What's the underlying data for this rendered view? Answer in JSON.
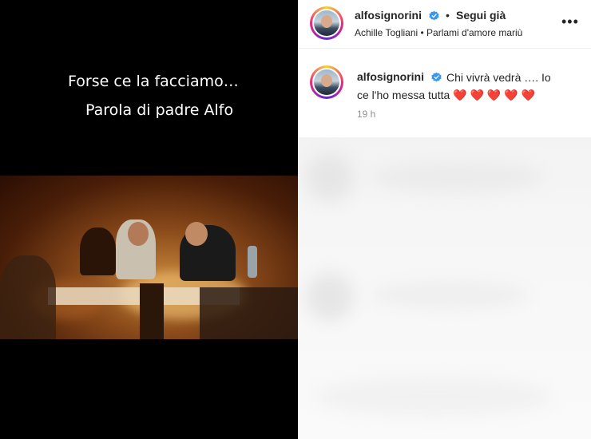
{
  "video": {
    "caption_line1": "Forse ce la facciamo…",
    "caption_line2": "Parola di padre Alfo"
  },
  "header": {
    "username": "alfosignorini",
    "separator": "•",
    "follow_label": "Segui già",
    "subtitle": "Achille Togliani • Parlami d'amore mariù",
    "more_label": "•••"
  },
  "post": {
    "username": "alfosignorini",
    "text_line1": "Chi vivrà vedrà …. Io",
    "text_line2": "ce l'ho messa tutta ❤️ ❤️ ❤️ ❤️ ❤️",
    "time": "19 h"
  },
  "colors": {
    "verified": "#3897f0",
    "heart": "#ed4956"
  }
}
